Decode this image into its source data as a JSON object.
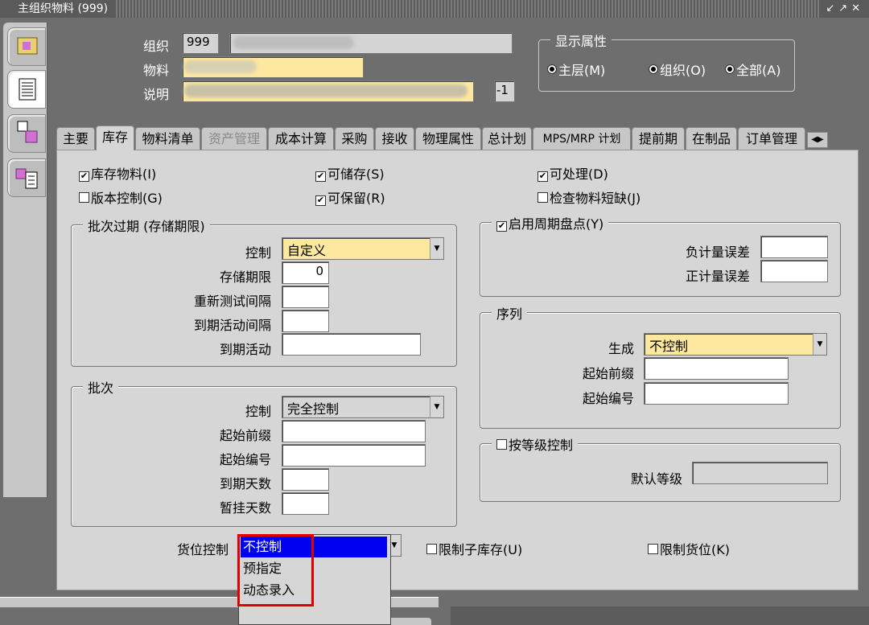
{
  "window": {
    "title": "主组织物料 (999)",
    "buttons": "↙↗✕"
  },
  "header": {
    "org_label": "组织",
    "org_value": "999",
    "item_label": "物料",
    "item_value": "",
    "desc_label": "说明",
    "desc_value": "",
    "desc_suffix": "-1",
    "display_attrs": {
      "legend": "显示属性",
      "options": [
        "主层(M)",
        "组织(O)",
        "全部(A)"
      ]
    }
  },
  "tabs": [
    "主要",
    "库存",
    "物料清单",
    "资产管理",
    "成本计算",
    "采购",
    "接收",
    "物理属性",
    "总计划",
    "MPS/MRP 计划",
    "提前期",
    "在制品",
    "订单管理"
  ],
  "active_tab": "库存",
  "disabled_tab": "资产管理",
  "checkboxes": {
    "inventory_item": {
      "label": "库存物料(I)",
      "checked": true
    },
    "stockable": {
      "label": "可储存(S)",
      "checked": true
    },
    "transactable": {
      "label": "可处理(D)",
      "checked": true
    },
    "revision_control": {
      "label": "版本控制(G)",
      "checked": false
    },
    "reservable": {
      "label": "可保留(R)",
      "checked": true
    },
    "check_shortages": {
      "label": "检查物料短缺(J)",
      "checked": false
    }
  },
  "lot_expiration": {
    "legend": "批次过期 (存储期限)",
    "control_label": "控制",
    "control_value": "自定义",
    "shelf_life_label": "存储期限",
    "shelf_life_value": "0",
    "retest_label": "重新测试间隔",
    "expiry_interval_label": "到期活动间隔",
    "expiry_action_label": "到期活动"
  },
  "lot": {
    "legend": "批次",
    "control_label": "控制",
    "control_value": "完全控制",
    "prefix_label": "起始前缀",
    "number_label": "起始编号",
    "maturity_label": "到期天数",
    "hold_label": "暂挂天数"
  },
  "cycle_count": {
    "legend": "启用周期盘点(Y)",
    "checked": true,
    "neg_label": "负计量误差",
    "pos_label": "正计量误差"
  },
  "serial": {
    "legend": "序列",
    "gen_label": "生成",
    "gen_value": "不控制",
    "prefix_label": "起始前缀",
    "number_label": "起始编号"
  },
  "grade": {
    "legend": "按等级控制",
    "checked": false,
    "default_label": "默认等级"
  },
  "locator": {
    "label": "货位控制",
    "options": [
      "不控制",
      "预指定",
      "动态录入"
    ],
    "selected": "不控制"
  },
  "restrict_subinv": {
    "label": "限制子库存(U)",
    "checked": false
  },
  "restrict_locator": {
    "label": "限制货位(K)",
    "checked": false
  }
}
